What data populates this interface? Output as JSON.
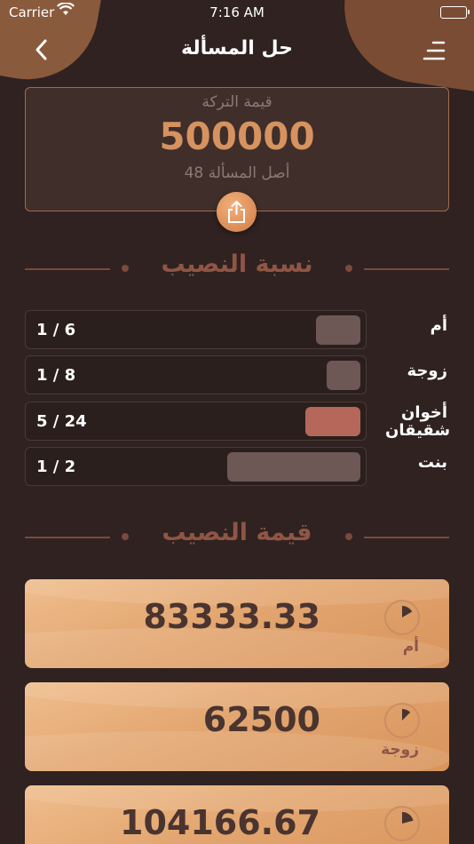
{
  "status_bar": {
    "carrier": "Carrier",
    "time": "7:16 AM"
  },
  "nav": {
    "title": "حل المسألة",
    "back_icon": "chevron-left-icon",
    "menu_icon": "menu-icon"
  },
  "total": {
    "label": "قيمة التركة",
    "amount": "500000",
    "origin_label": "أصل المسألة",
    "origin_value": "48",
    "share_icon": "share-icon"
  },
  "ratio_section": {
    "title": "نسبة النصيب",
    "rows": [
      {
        "name": "أم",
        "fraction": "1 / 6",
        "share": 0.1667,
        "color": "#6d5856"
      },
      {
        "name": "زوجة",
        "fraction": "1 / 8",
        "share": 0.125,
        "color": "#6d5856"
      },
      {
        "name": "أخوان شقيقان",
        "fraction": "5 / 24",
        "share": 0.2083,
        "color": "#b5675a"
      },
      {
        "name": "بنت",
        "fraction": "1 / 2",
        "share": 0.5,
        "color": "#6d5856"
      }
    ]
  },
  "value_section": {
    "title": "قيمة النصيب",
    "cards": [
      {
        "value": "83333.33",
        "name": "أم",
        "share": 0.1667
      },
      {
        "value": "62500",
        "name": "زوجة",
        "share": 0.125
      },
      {
        "value": "104166.67",
        "name": "",
        "share": 0.2083
      }
    ]
  }
}
